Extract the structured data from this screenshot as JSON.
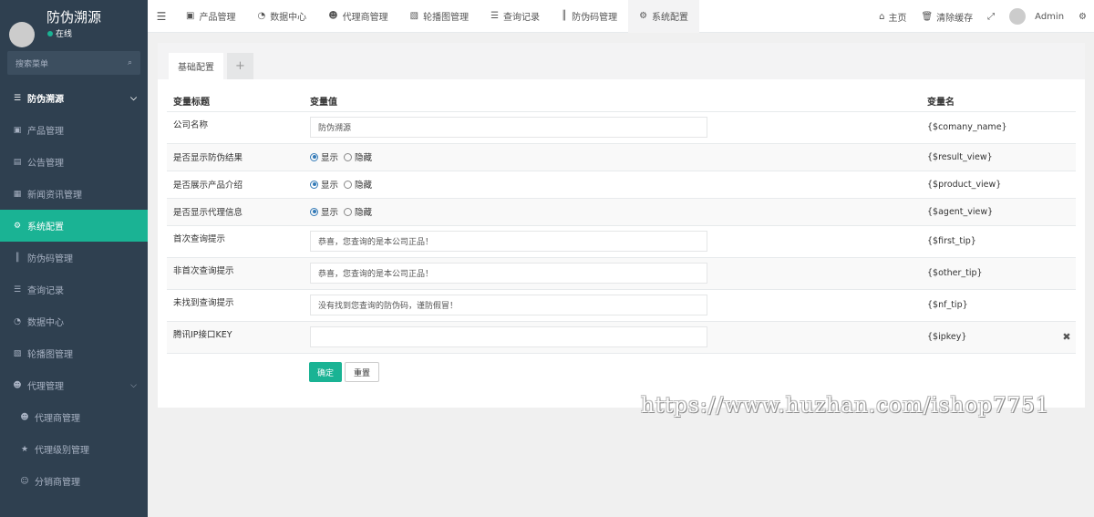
{
  "sidebar": {
    "app_title": "防伪溯源",
    "status": "在线",
    "search_placeholder": "搜索菜单",
    "items": [
      {
        "label": "防伪溯源",
        "icon": "list-icon",
        "type": "group"
      },
      {
        "label": "产品管理",
        "icon": "briefcase-icon",
        "type": "item"
      },
      {
        "label": "公告管理",
        "icon": "file-icon",
        "type": "item"
      },
      {
        "label": "新闻资讯管理",
        "icon": "newspaper-icon",
        "type": "item"
      },
      {
        "label": "系统配置",
        "icon": "gear-icon",
        "type": "active"
      },
      {
        "label": "防伪码管理",
        "icon": "barcode-icon",
        "type": "item"
      },
      {
        "label": "查询记录",
        "icon": "list-icon",
        "type": "item"
      },
      {
        "label": "数据中心",
        "icon": "dashboard-icon",
        "type": "item"
      },
      {
        "label": "轮播图管理",
        "icon": "image-icon",
        "type": "item"
      },
      {
        "label": "代理管理",
        "icon": "users-icon",
        "type": "item"
      },
      {
        "label": "代理商管理",
        "icon": "users-icon",
        "type": "sub"
      },
      {
        "label": "代理级别管理",
        "icon": "star-icon",
        "type": "sub"
      },
      {
        "label": "分销商管理",
        "icon": "user-circle-icon",
        "type": "sub"
      }
    ]
  },
  "topbar": {
    "tabs": [
      {
        "label": "产品管理",
        "icon": "briefcase-icon"
      },
      {
        "label": "数据中心",
        "icon": "dashboard-icon"
      },
      {
        "label": "代理商管理",
        "icon": "users-icon"
      },
      {
        "label": "轮播图管理",
        "icon": "image-icon"
      },
      {
        "label": "查询记录",
        "icon": "list-icon"
      },
      {
        "label": "防伪码管理",
        "icon": "barcode-icon"
      },
      {
        "label": "系统配置",
        "icon": "gear-icon"
      }
    ],
    "home": "主页",
    "clear_cache": "清除缓存",
    "user": "Admin"
  },
  "panel": {
    "tab_active": "基础配置",
    "tab_add": "+",
    "headers": {
      "title": "变量标题",
      "value": "变量值",
      "name": "变量名"
    },
    "rows": [
      {
        "title": "公司名称",
        "kind": "input",
        "value": "防伪溯源",
        "var": "{$comany_name}"
      },
      {
        "title": "是否显示防伪结果",
        "kind": "radio",
        "on": "显示",
        "off": "隐藏",
        "var": "{$result_view}"
      },
      {
        "title": "是否展示产品介绍",
        "kind": "radio",
        "on": "显示",
        "off": "隐藏",
        "var": "{$product_view}"
      },
      {
        "title": "是否显示代理信息",
        "kind": "radio",
        "on": "显示",
        "off": "隐藏",
        "var": "{$agent_view}"
      },
      {
        "title": "首次查询提示",
        "kind": "input",
        "value": "恭喜，您查询的是本公司正品！",
        "var": "{$first_tip}"
      },
      {
        "title": "非首次查询提示",
        "kind": "input",
        "value": "恭喜，您查询的是本公司正品！",
        "var": "{$other_tip}"
      },
      {
        "title": "未找到查询提示",
        "kind": "input",
        "value": "没有找到您查询的防伪码，谨防假冒！",
        "var": "{$nf_tip}"
      },
      {
        "title": "腾讯IP接口KEY",
        "kind": "input",
        "value": "",
        "var": "{$ipkey}"
      }
    ],
    "confirm": "确定",
    "reset": "重置"
  },
  "watermark": "https://www.huzhan.com/ishop7751"
}
